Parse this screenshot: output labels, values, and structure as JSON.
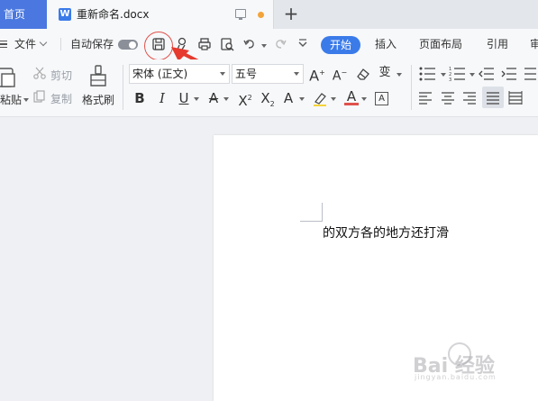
{
  "tabs": {
    "home": "首页",
    "document": "重新命名.docx",
    "new_tab": "+"
  },
  "menu": {
    "file": "文件",
    "autosave": "自动保存"
  },
  "ribbon_tabs": [
    "开始",
    "插入",
    "页面布局",
    "引用",
    "审"
  ],
  "clipboard": {
    "paste": "粘贴",
    "cut": "剪切",
    "copy": "复制",
    "format_painter": "格式刷"
  },
  "font": {
    "family": "宋体 (正文)",
    "size": "五号"
  },
  "document": {
    "body_text": "的双方各的地方还打滑"
  },
  "watermark": {
    "logo": "Bai 经验",
    "url": "jingyan.baidu.com"
  },
  "colors": {
    "accent": "#3b7be9",
    "home_tab": "#4a78e0",
    "highlight_circle": "#e0524b",
    "unsaved_dot": "#f2a43a"
  }
}
